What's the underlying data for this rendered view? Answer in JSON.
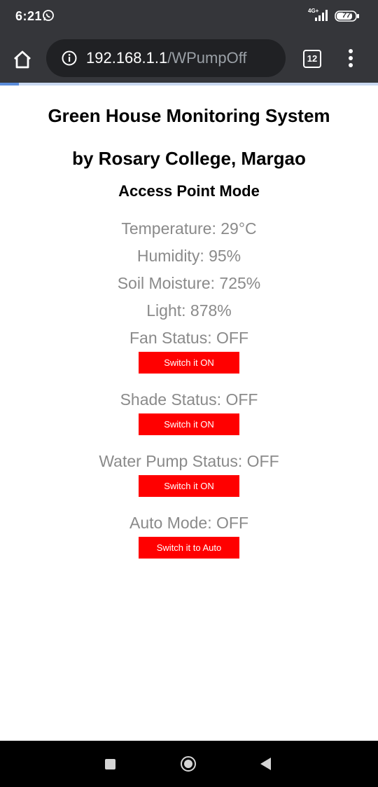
{
  "status_bar": {
    "time": "6:21",
    "network": "4G+",
    "battery": "77"
  },
  "browser": {
    "url_host": "192.168.1.1",
    "url_path": "/WPumpOff",
    "tab_count": "12",
    "page_load_progress": 0.05
  },
  "page": {
    "title": "Green House Monitoring System",
    "subtitle": "by Rosary College, Margao",
    "mode": "Access Point Mode",
    "readings": {
      "temperature": "Temperature: 29°C",
      "humidity": "Humidity: 95%",
      "soil_moisture": "Soil Moisture: 725%",
      "light": "Light: 878%"
    },
    "controls": {
      "fan_status": "Fan Status: OFF",
      "fan_button": "Switch it ON",
      "shade_status": "Shade Status: OFF",
      "shade_button": "Switch it ON",
      "pump_status": "Water Pump Status: OFF",
      "pump_button": "Switch it ON",
      "auto_status": "Auto Mode: OFF",
      "auto_button": "Switch it to Auto"
    }
  },
  "colors": {
    "chrome_bg": "#35363a",
    "omnibox_bg": "#202124",
    "button_red": "#ff0000",
    "reading_gray": "#8a8a8a"
  },
  "icons": {
    "home": "home-icon",
    "info": "info-icon",
    "menu": "more-vert-icon",
    "whatsapp": "whatsapp-icon",
    "signal": "signal-icon",
    "battery": "battery-icon"
  }
}
